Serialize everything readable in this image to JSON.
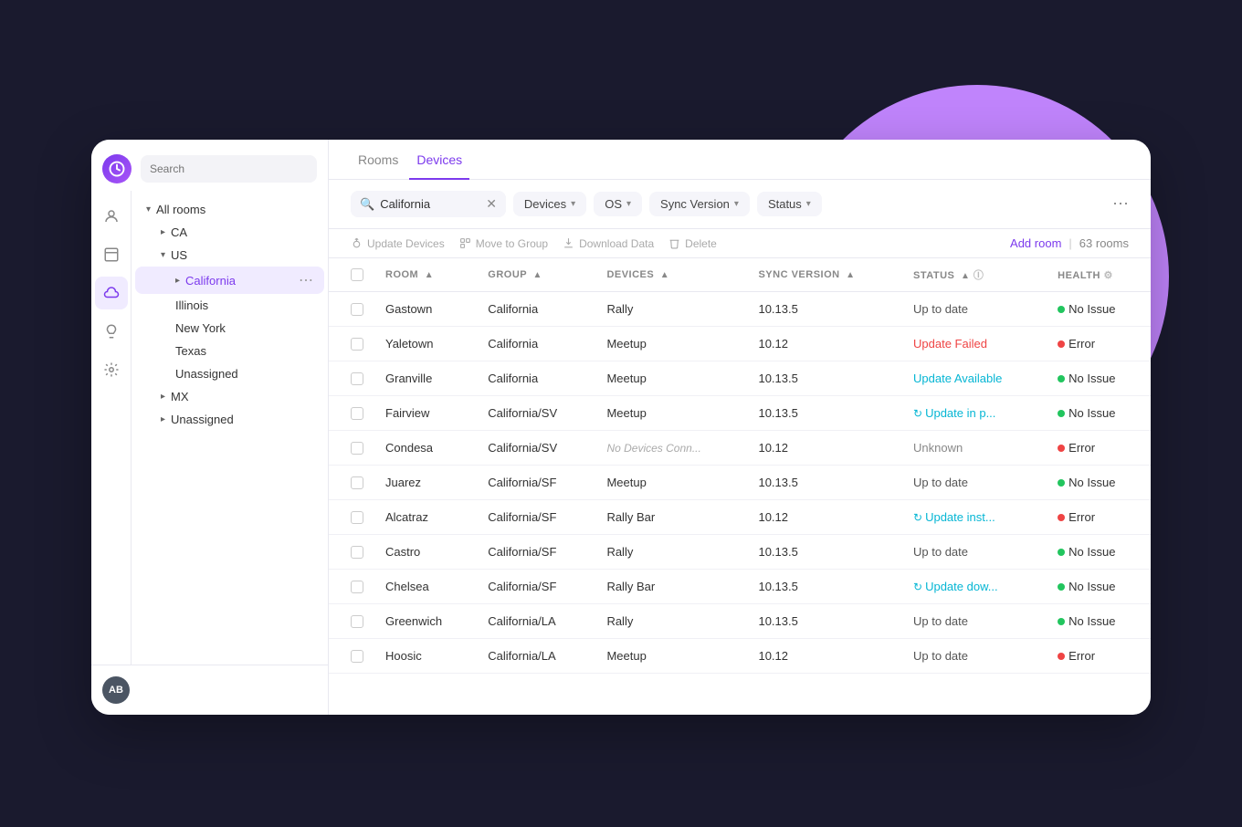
{
  "app": {
    "logo": "↻"
  },
  "sidebar": {
    "search_placeholder": "Search",
    "nav_icons": [
      {
        "name": "rooms-icon",
        "icon": "👤",
        "active": false
      },
      {
        "name": "book-icon",
        "icon": "📋",
        "active": false
      },
      {
        "name": "cloud-icon",
        "icon": "☁",
        "active": true
      },
      {
        "name": "bulb-icon",
        "icon": "💡",
        "active": false
      },
      {
        "name": "gear-icon",
        "icon": "⚙",
        "active": false
      }
    ],
    "tree": {
      "all_rooms_label": "All rooms",
      "ca_label": "CA",
      "us_label": "US",
      "california_label": "California",
      "illinois_label": "Illinois",
      "newyork_label": "New York",
      "texas_label": "Texas",
      "unassigned_us_label": "Unassigned",
      "mx_label": "MX",
      "unassigned_label": "Unassigned"
    },
    "avatar_initials": "AB"
  },
  "header": {
    "tabs": [
      {
        "label": "Rooms",
        "active": false
      },
      {
        "label": "Devices",
        "active": true
      }
    ]
  },
  "toolbar": {
    "search_value": "California",
    "filters": [
      {
        "label": "Devices",
        "name": "devices-filter"
      },
      {
        "label": "OS",
        "name": "os-filter"
      },
      {
        "label": "Sync Version",
        "name": "syncversion-filter"
      },
      {
        "label": "Status",
        "name": "status-filter"
      }
    ]
  },
  "actions": {
    "update_devices": "Update Devices",
    "move_to_group": "Move to Group",
    "download_data": "Download Data",
    "delete": "Delete",
    "add_room": "Add room",
    "rooms_count": "63 rooms"
  },
  "table": {
    "columns": [
      {
        "label": "ROOM",
        "sortable": true,
        "name": "room-col"
      },
      {
        "label": "GROUP",
        "sortable": true,
        "name": "group-col"
      },
      {
        "label": "DEVICES",
        "sortable": true,
        "name": "devices-col"
      },
      {
        "label": "SYNC VERSION",
        "sortable": true,
        "name": "syncversion-col"
      },
      {
        "label": "STATUS",
        "sortable": true,
        "name": "status-col"
      },
      {
        "label": "HEALTH",
        "sortable": true,
        "name": "health-col"
      }
    ],
    "rows": [
      {
        "room": "Gastown",
        "group": "California",
        "devices": "Rally",
        "sync_version": "10.13.5",
        "status": "Up to date",
        "status_type": "uptodate",
        "health": "No Issue",
        "health_type": "green"
      },
      {
        "room": "Yaletown",
        "group": "California",
        "devices": "Meetup",
        "sync_version": "10.12",
        "status": "Update Failed",
        "status_type": "failed",
        "health": "Error",
        "health_type": "red"
      },
      {
        "room": "Granville",
        "group": "California",
        "devices": "Meetup",
        "sync_version": "10.13.5",
        "status": "Update Available",
        "status_type": "available",
        "health": "No Issue",
        "health_type": "green"
      },
      {
        "room": "Fairview",
        "group": "California/SV",
        "devices": "Meetup",
        "sync_version": "10.13.5",
        "status": "Update in p...",
        "status_type": "updating",
        "health": "No Issue",
        "health_type": "green"
      },
      {
        "room": "Condesa",
        "group": "California/SV",
        "devices": "",
        "sync_version": "10.12",
        "status": "Unknown",
        "status_type": "unknown",
        "health": "Error",
        "health_type": "red"
      },
      {
        "room": "Juarez",
        "group": "California/SF",
        "devices": "Meetup",
        "sync_version": "10.13.5",
        "status": "Up to date",
        "status_type": "uptodate",
        "health": "No Issue",
        "health_type": "green"
      },
      {
        "room": "Alcatraz",
        "group": "California/SF",
        "devices": "Rally Bar",
        "sync_version": "10.12",
        "status": "Update inst...",
        "status_type": "updating",
        "health": "Error",
        "health_type": "red"
      },
      {
        "room": "Castro",
        "group": "California/SF",
        "devices": "Rally",
        "sync_version": "10.13.5",
        "status": "Up to date",
        "status_type": "uptodate",
        "health": "No Issue",
        "health_type": "green"
      },
      {
        "room": "Chelsea",
        "group": "California/SF",
        "devices": "Rally Bar",
        "sync_version": "10.13.5",
        "status": "Update dow...",
        "status_type": "updating",
        "health": "No Issue",
        "health_type": "green"
      },
      {
        "room": "Greenwich",
        "group": "California/LA",
        "devices": "Rally",
        "sync_version": "10.13.5",
        "status": "Up to date",
        "status_type": "uptodate",
        "health": "No Issue",
        "health_type": "green"
      },
      {
        "room": "Hoosic",
        "group": "California/LA",
        "devices": "Meetup",
        "sync_version": "10.12",
        "status": "Up to date",
        "status_type": "uptodate",
        "health": "Error",
        "health_type": "red"
      }
    ]
  }
}
